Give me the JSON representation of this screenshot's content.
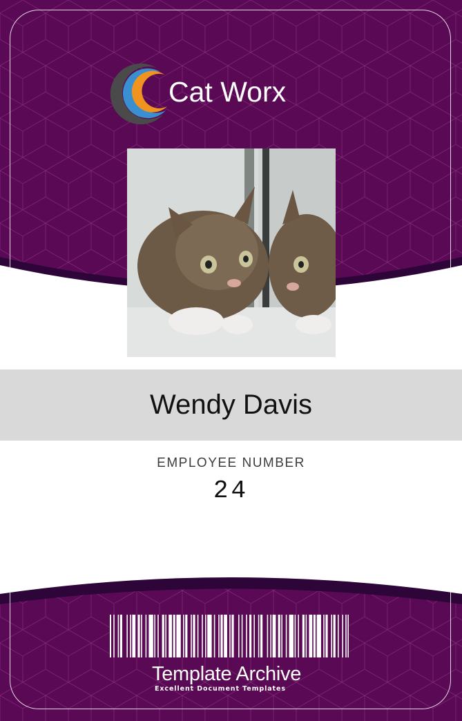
{
  "header": {
    "company_name": "Cat Worx",
    "logo_icon": "swoosh-logo-icon"
  },
  "photo": {
    "alt": "Kitten looking at its reflection in a mirror"
  },
  "employee": {
    "name": "Wendy Davis",
    "number_label": "EMPLOYEE NUMBER",
    "number": "24"
  },
  "footer": {
    "barcode_icon": "barcode-icon",
    "brand": "Template Archive",
    "tagline": "Excellent Document Templates"
  },
  "colors": {
    "primary": "#5a0a55",
    "dark_band": "#2e0538",
    "name_band": "#d9d9d9",
    "logo_orange": "#f0941f",
    "logo_blue": "#3a8fd0",
    "logo_gray": "#555555"
  }
}
